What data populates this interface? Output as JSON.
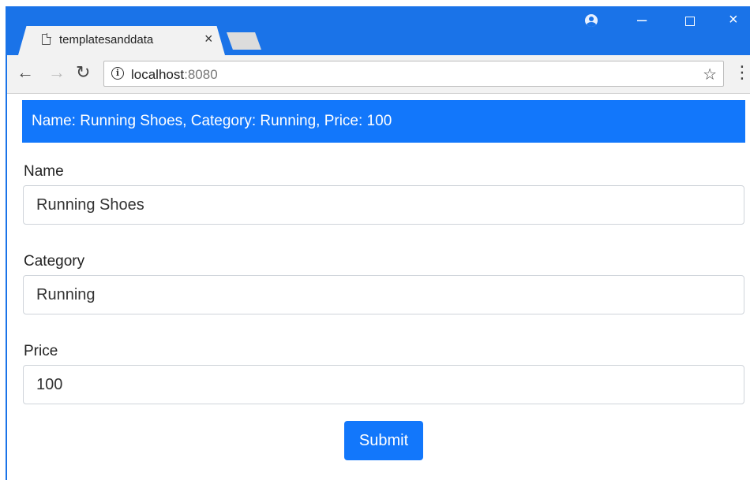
{
  "browser": {
    "tab_title": "templatesanddata",
    "tab_close": "×",
    "url_host": "localhost",
    "url_port": ":8080",
    "controls": {
      "minimize": "–",
      "close": "×"
    }
  },
  "page": {
    "summary": "Name: Running Shoes, Category: Running, Price: 100",
    "fields": [
      {
        "label": "Name",
        "value": "Running Shoes"
      },
      {
        "label": "Category",
        "value": "Running"
      },
      {
        "label": "Price",
        "value": "100"
      }
    ],
    "submit_label": "Submit"
  },
  "colors": {
    "titlebar": "#1a73e8",
    "primary": "#1277fb"
  }
}
